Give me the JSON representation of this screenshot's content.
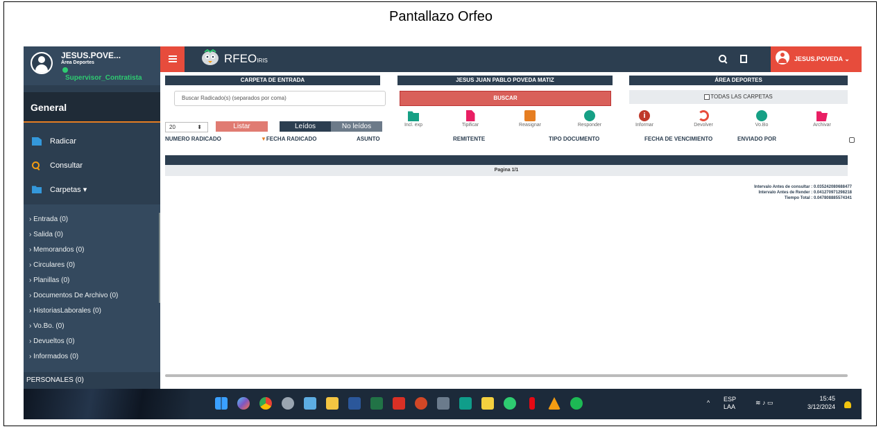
{
  "caption": "Pantallazo Orfeo",
  "sidebar": {
    "user_name": "JESUS.POVE...",
    "user_area": "Área Deportes",
    "user_role": "Supervisor_Contratista",
    "section": "General",
    "items": [
      {
        "label": "Radicar",
        "icon": "file-icon"
      },
      {
        "label": "Consultar",
        "icon": "search-icon"
      },
      {
        "label": "Carpetas ▾",
        "icon": "folder-icon"
      }
    ],
    "folders": [
      "› Entrada (0)",
      "› Salida (0)",
      "› Memorandos (0)",
      "› Circulares (0)",
      "› Planillas (0)",
      "› Documentos De Archivo (0)",
      "› HistoriasLaborales (0)",
      "› Vo.Bo. (0)",
      "› Devueltos (0)",
      "› Informados (0)"
    ],
    "personales": "PERSONALES (0)"
  },
  "topbar": {
    "logo_text": "RFEO",
    "logo_sub": "IRIS",
    "user_menu": "JESUS.POVEDA ⌄"
  },
  "main": {
    "headers": [
      "CARPETA DE ENTRADA",
      "JESUS JUAN PABLO POVEDA MATIZ",
      "ÁREA DEPORTES"
    ],
    "search_placeholder": "Buscar Radicado(s) (separados por coma)",
    "buscar_label": "BUSCAR",
    "todas_label": "TODAS LAS CARPETAS",
    "count_value": "20",
    "listar_label": "Listar",
    "leidos_label": "Leídos",
    "no_leidos_label": "No leídos",
    "actions": [
      {
        "label": "Incl. exp",
        "icon": "folder-icon"
      },
      {
        "label": "Tipificar",
        "icon": "file-icon"
      },
      {
        "label": "Reasignar",
        "icon": "list-icon"
      },
      {
        "label": "Responder",
        "icon": "chat-icon"
      },
      {
        "label": "Informar",
        "icon": "info-icon"
      },
      {
        "label": "Devolver",
        "icon": "undo-icon"
      },
      {
        "label": "Vo.Bo",
        "icon": "check-icon"
      },
      {
        "label": "Archivar",
        "icon": "folder-open-icon"
      }
    ],
    "columns": [
      "NUMERO RADICADO",
      "FECHA RADICADO",
      "ASUNTO",
      "REMITENTE",
      "TIPO DOCUMENTO",
      "FECHA DE VENCIMIENTO",
      "ENVIADO POR"
    ],
    "paging": "Pagina 1/1",
    "timing": [
      "Intervalo Antes de consultar : 0.035242080688477",
      "Intervalo Antes de Render : 0.041270971298218",
      "Tiempo Total : 0.047808885574341"
    ]
  },
  "taskbar": {
    "lang": "ESP",
    "lang_sub": "LAA",
    "time": "15:45",
    "date": "3/12/2024"
  }
}
